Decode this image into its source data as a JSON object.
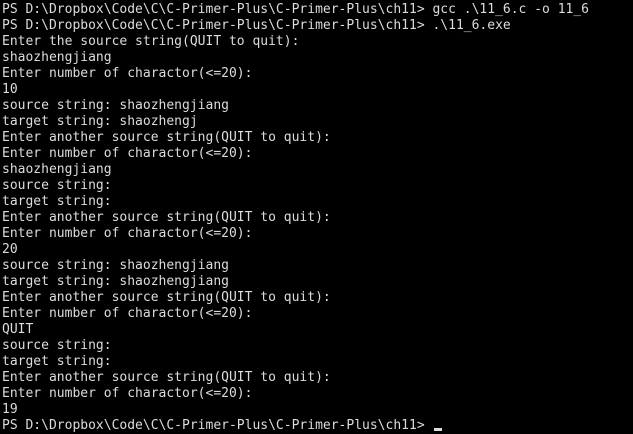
{
  "terminal": {
    "lines": [
      "PS D:\\Dropbox\\Code\\C\\C-Primer-Plus\\C-Primer-Plus\\ch11> gcc .\\11_6.c -o 11_6",
      "PS D:\\Dropbox\\Code\\C\\C-Primer-Plus\\C-Primer-Plus\\ch11> .\\11_6.exe",
      "Enter the source string(QUIT to quit):",
      "shaozhengjiang",
      "Enter number of charactor(<=20):",
      "10",
      "source string: shaozhengjiang",
      "target string: shaozhengj",
      "Enter another source string(QUIT to quit):",
      "Enter number of charactor(<=20):",
      "shaozhengjiang",
      "source string:",
      "target string:",
      "Enter another source string(QUIT to quit):",
      "Enter number of charactor(<=20):",
      "20",
      "source string: shaozhengjiang",
      "target string: shaozhengjiang",
      "Enter another source string(QUIT to quit):",
      "Enter number of charactor(<=20):",
      "QUIT",
      "source string:",
      "target string:",
      "Enter another source string(QUIT to quit):",
      "Enter number of charactor(<=20):",
      "19",
      "PS D:\\Dropbox\\Code\\C\\C-Primer-Plus\\C-Primer-Plus\\ch11> "
    ]
  }
}
